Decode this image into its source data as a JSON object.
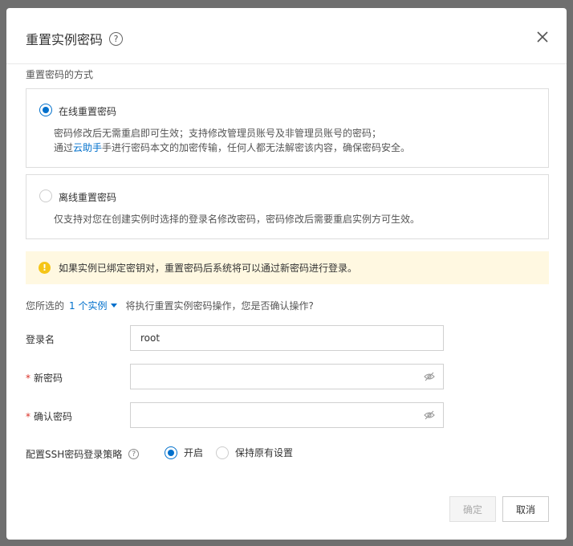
{
  "modal": {
    "title": "重置实例密码",
    "help_icon": "question-circle-icon",
    "close_icon": "close-icon"
  },
  "method": {
    "label": "重置密码的方式",
    "options": [
      {
        "title": "在线重置密码",
        "checked": true,
        "desc_line1": "密码修改后无需重启即可生效；支持修改管理员账号及非管理员账号的密码；",
        "desc_line2_pre": "通过",
        "desc_line2_link": "云助手",
        "desc_line2_post": "手进行密码本文的加密传输，任何人都无法解密该内容，确保密码安全。"
      },
      {
        "title": "离线重置密码",
        "checked": false,
        "desc_line1": "仅支持对您在创建实例时选择的登录名修改密码，密码修改后需要重启实例方可生效。"
      }
    ]
  },
  "alert": {
    "icon": "warning-icon",
    "text": "如果实例已绑定密钥对，重置密码后系统将可以通过新密码进行登录。"
  },
  "confirm": {
    "prefix": "您所选的",
    "instance_link": "1 个实例",
    "suffix": "将执行重置实例密码操作，您是否确认操作?"
  },
  "form": {
    "login_label": "登录名",
    "login_value": "root",
    "new_password_label": "新密码",
    "confirm_password_label": "确认密码",
    "required_mark": "*",
    "ssh_label": "配置SSH密码登录策略",
    "ssh_options": [
      "开启",
      "保持原有设置"
    ]
  },
  "footer": {
    "ok_label": "确定",
    "cancel_label": "取消"
  },
  "colors": {
    "accent": "#0070cc",
    "warning": "#f5c518",
    "alert_bg": "#fff8e1",
    "required": "#d93026"
  }
}
